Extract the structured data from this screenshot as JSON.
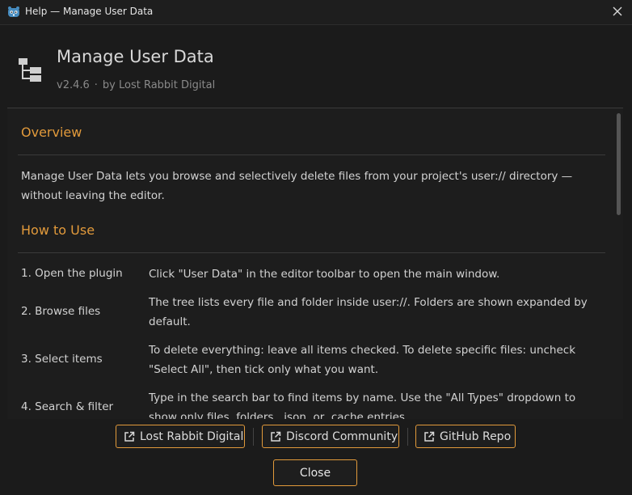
{
  "window": {
    "title": "Help — Manage User Data",
    "accent": "#e29a3b"
  },
  "header": {
    "title": "Manage User Data",
    "version": "v2.4.6",
    "separator": "·",
    "author": "by Lost Rabbit Digital"
  },
  "content": {
    "overview_heading": "Overview",
    "overview_text": "Manage User Data lets you browse and selectively delete files from your project's user:// directory — without leaving the editor.",
    "howto_heading": "How to Use",
    "steps": [
      {
        "label": "1.  Open the plugin",
        "desc": "Click \"User Data\" in the editor toolbar to open the main window."
      },
      {
        "label": "2.  Browse files",
        "desc": "The tree lists every file and folder inside user://. Folders are shown expanded by default."
      },
      {
        "label": "3.  Select items",
        "desc": "To delete everything: leave all items checked. To delete specific files: uncheck \"Select All\", then tick only what you want."
      },
      {
        "label": "4.  Search & filter",
        "desc": "Type in the search bar to find items by name. Use the \"All Types\" dropdown to show only files, folders, .json, or .cache entries."
      }
    ]
  },
  "footer": {
    "links": [
      {
        "label": "Lost Rabbit Digital",
        "icon": "external-link-icon"
      },
      {
        "label": "Discord Community",
        "icon": "external-link-icon"
      },
      {
        "label": "GitHub Repo",
        "icon": "external-link-icon"
      }
    ],
    "close_label": "Close"
  }
}
